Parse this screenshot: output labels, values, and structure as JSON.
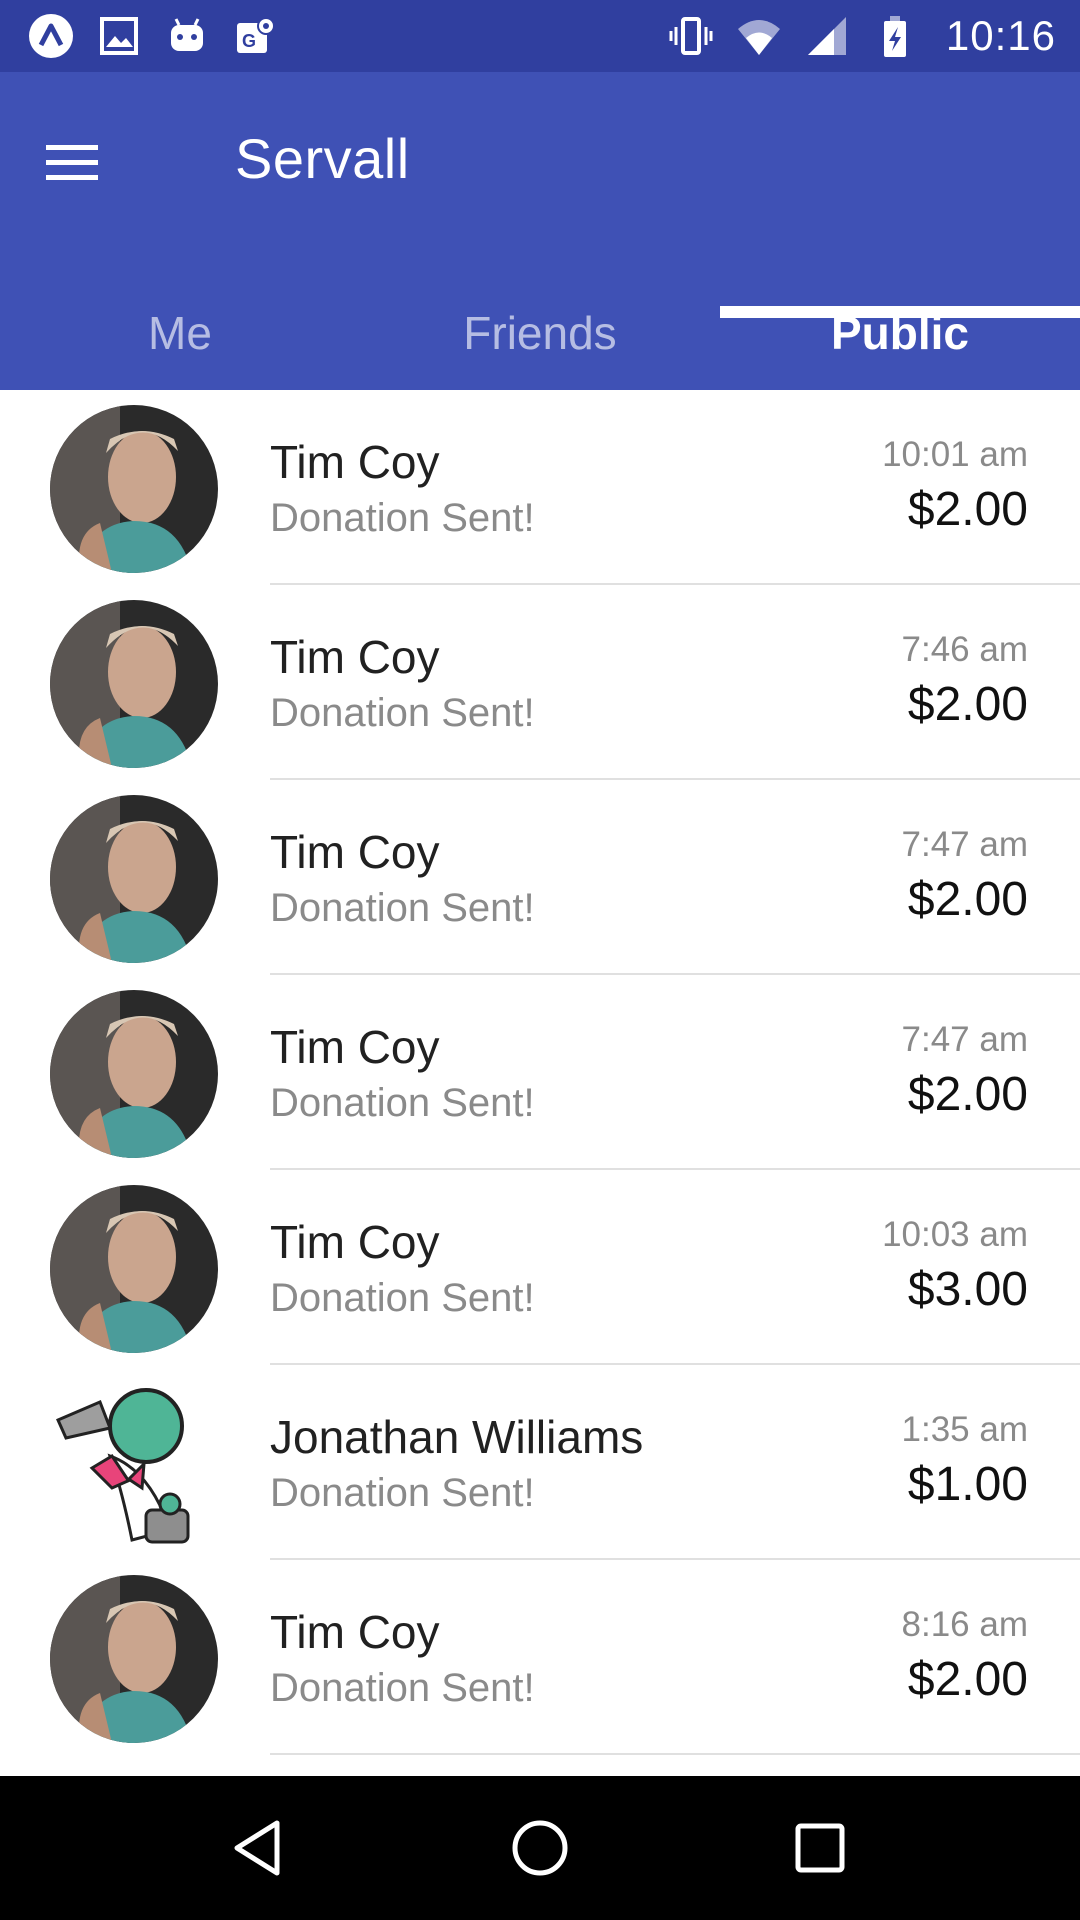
{
  "status_bar": {
    "time": "10:16",
    "left_icons": [
      "app-a-icon",
      "image-icon",
      "android-icon",
      "maps-icon"
    ],
    "right_icons": [
      "vibrate-icon",
      "wifi-icon",
      "signal-icon",
      "battery-charging-icon"
    ]
  },
  "app_bar": {
    "title": "Servall",
    "color": "#3f51b5",
    "status_color": "#303f9f"
  },
  "tabs": [
    {
      "label": "Me",
      "active": false
    },
    {
      "label": "Friends",
      "active": false
    },
    {
      "label": "Public",
      "active": true
    }
  ],
  "donations": [
    {
      "name": "Tim Coy",
      "status": "Donation Sent!",
      "time": "10:01 am",
      "amount": "$2.00",
      "avatar": "photo"
    },
    {
      "name": "Tim Coy",
      "status": "Donation Sent!",
      "time": "7:46 am",
      "amount": "$2.00",
      "avatar": "photo"
    },
    {
      "name": "Tim Coy",
      "status": "Donation Sent!",
      "time": "7:47 am",
      "amount": "$2.00",
      "avatar": "photo"
    },
    {
      "name": "Tim Coy",
      "status": "Donation Sent!",
      "time": "7:47 am",
      "amount": "$2.00",
      "avatar": "photo"
    },
    {
      "name": "Tim Coy",
      "status": "Donation Sent!",
      "time": "10:03 am",
      "amount": "$3.00",
      "avatar": "photo"
    },
    {
      "name": "Jonathan Williams",
      "status": "Donation Sent!",
      "time": "1:35 am",
      "amount": "$1.00",
      "avatar": "cartoon"
    },
    {
      "name": "Tim Coy",
      "status": "Donation Sent!",
      "time": "8:16 am",
      "amount": "$2.00",
      "avatar": "photo"
    }
  ],
  "nav_bar": {
    "buttons": [
      "back-icon",
      "home-icon",
      "recents-icon"
    ]
  }
}
